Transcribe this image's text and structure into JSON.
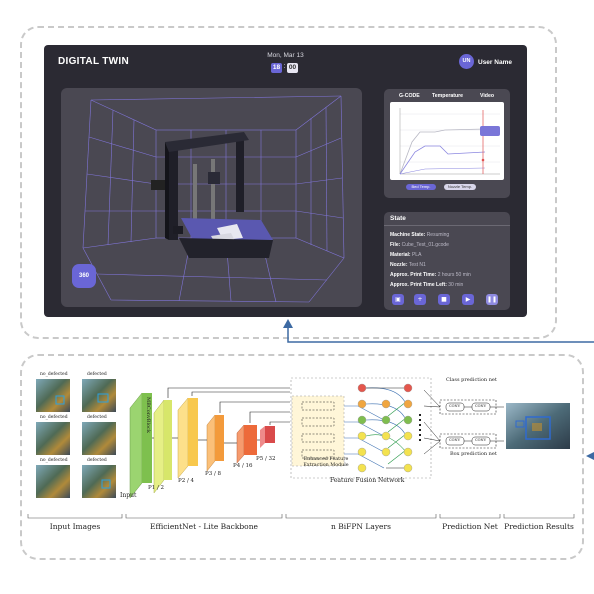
{
  "app": {
    "title": "DIGITAL TWIN",
    "date": "Mon, Mar 13",
    "time_hours": "18",
    "time_separator": ":",
    "time_minutes": "00",
    "user_initials": "UN",
    "user_name": "User Name",
    "view_button": "360",
    "chart_tabs": [
      "G-CODE",
      "Temperature",
      "Video"
    ],
    "legend": [
      "Bed Temp.",
      "Nozzle Temp."
    ],
    "state": {
      "title": "State",
      "rows": [
        {
          "label": "Machine State:",
          "value": "Resuming"
        },
        {
          "label": "File:",
          "value": "Cube_Test_01.gcode"
        },
        {
          "label": "Material:",
          "value": "PLA"
        },
        {
          "label": "Nozzle:",
          "value": "Test N1"
        },
        {
          "label": "Approx. Print Time:",
          "value": "2 hours 50 min"
        },
        {
          "label": "Approx. Print Time Left:",
          "value": "30 min"
        }
      ]
    }
  },
  "diagram": {
    "input_images": [
      {
        "label": "no_defected"
      },
      {
        "label": "defected"
      },
      {
        "label": "no_defected"
      },
      {
        "label": "defected"
      },
      {
        "label": "no_defected"
      },
      {
        "label": "defected"
      }
    ],
    "input_label": "Input",
    "backbone_block_label": "MBConvBlock",
    "feature_labels": [
      "P1 / 2",
      "P2 / 4",
      "P3 / 8",
      "P4 / 16",
      "P5 / 32"
    ],
    "efm_label": "Enhanced Feature Extraction Module",
    "ffn_label": "Feature Fusion Network",
    "class_net_label": "Class prediction net",
    "box_net_label": "Box prediction net",
    "conv_label": "CONV",
    "stages": [
      "Input Images",
      "EfficientNet - Lite Backbone",
      "n BiFPN Layers",
      "Prediction Net",
      "Prediction Results"
    ]
  },
  "colors": {
    "accent": "#6a66d6",
    "app_bg": "#2b2a33",
    "panel_bg": "#4a4852",
    "arrow": "#3d6aa3",
    "node_red": "#e4564c",
    "node_orange": "#f0a640",
    "node_green": "#7fbd4f",
    "node_yellow": "#f3e24f"
  },
  "icons": {
    "print_control": [
      "printer-icon",
      "plus-icon",
      "stop-icon",
      "play-icon",
      "pause-icon"
    ]
  }
}
